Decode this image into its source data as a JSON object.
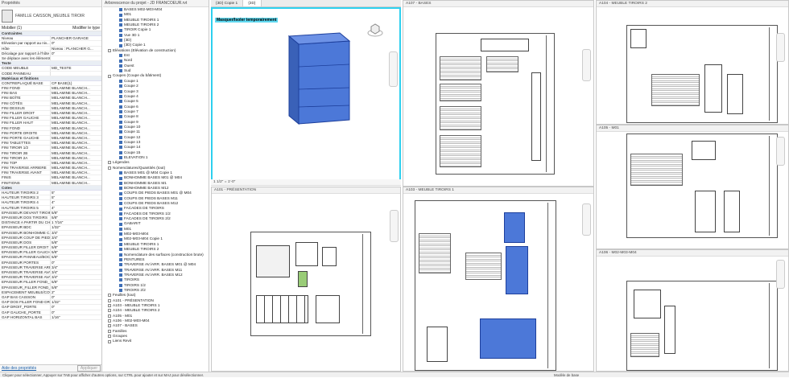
{
  "properties": {
    "title": "Propriétés",
    "type_name": "FAMILLE CAISSON_MEUBLE TIROIR",
    "instance_selector": "Mobilier (1)",
    "edit_type": "Modifier le type",
    "groups": [
      {
        "name": "Contraintes",
        "rows": [
          [
            "Niveau",
            "PLANCHER GARAGE"
          ],
          [
            "Elévation par rapport au niv...",
            "0\""
          ],
          [
            "Hôte",
            "Niveau : PLANCHER G..."
          ],
          [
            "Décalage par rapport à l'hôte",
            "0\""
          ],
          [
            "Se déplace avec les éléments...",
            ""
          ]
        ]
      },
      {
        "name": "Texte",
        "rows": [
          [
            "CODE MEUBLE",
            "MD_TESTE"
          ],
          [
            "CODE PANNEAU",
            ""
          ]
        ]
      },
      {
        "name": "Matériaux et finitions",
        "rows": [
          [
            "CONTREPLAQUÉ BASE",
            "CP BASE(1)"
          ],
          [
            "FINI FOND",
            "MELAMINE BLANCH..."
          ],
          [
            "FINI BAS",
            "MELAMINE BLANCH..."
          ],
          [
            "FINI BOÎTE",
            "MELAMINE BLANCH..."
          ],
          [
            "FINI CÔTÉS",
            "MELAMINE BLANCH..."
          ],
          [
            "FINI DESSUS",
            "MELAMINE BLANCH..."
          ],
          [
            "FINI FILLER DROIT",
            "MELAMINE BLANCH..."
          ],
          [
            "FINI FILLER GAUCHE",
            "MELAMINE BLANCH..."
          ],
          [
            "FINI FILLER HAUT",
            "MELAMINE BLANCH..."
          ],
          [
            "FINI FOND",
            "MELAMINE BLANCH..."
          ],
          [
            "FINI PORTE DROITE",
            "MELAMINE BLANCH..."
          ],
          [
            "FINI PORTE GAUCHE",
            "MELAMINE BLANCH..."
          ],
          [
            "FINI TABLETTES",
            "MELAMINE BLANCH..."
          ],
          [
            "FINI TIROIR 1/2",
            "MELAMINE BLANCH..."
          ],
          [
            "FINI TIROIR 2B",
            "MELAMINE BLANCH..."
          ],
          [
            "FINI TIROIR 2A",
            "MELAMINE BLANCH..."
          ],
          [
            "FINI TOP",
            "MELAMINE BLANCH..."
          ],
          [
            "FINI TRAVERSE ARRIERE",
            "MELAMINE BLANCH..."
          ],
          [
            "FINI TRAVERSE AVANT",
            "MELAMINE BLANCH..."
          ],
          [
            "FINIS",
            "MELAMINE BLANCH..."
          ],
          [
            "FINITIONS",
            "MELAMINE BLANCH..."
          ]
        ]
      },
      {
        "name": "Cotes",
        "rows": [
          [
            "HAUTEUR TIROIRS 2",
            "5\""
          ],
          [
            "HAUTEUR TIROIRS 3",
            "5\""
          ],
          [
            "HAUTEUR TIROIRS 4",
            "4\""
          ],
          [
            "HAUTEUR TIROIRS 5",
            "4\""
          ],
          [
            "EPAISSEUR DEVANT TIROIRS",
            "5/8\""
          ],
          [
            "EPAISSEUR DOS TIROIRS",
            "5/8\""
          ],
          [
            "DISTANCE A PARTIR DU CH...",
            "1 7/16\""
          ],
          [
            "EPAISSEUR BDC",
            "1/32\""
          ],
          [
            "EPAISSEUR BONHOMME C...",
            "3/4\""
          ],
          [
            "EPAISSEUR COUP DE PIED",
            "3/4\""
          ],
          [
            "EPAISSEUR DOS",
            "5/8\""
          ],
          [
            "EPAISSEUR FILLER DROIT",
            "5/8\""
          ],
          [
            "EPAISSEUR FILLER GAUCHE",
            "5/8\""
          ],
          [
            "EPAISSEUR PANNEAU/BOC",
            "5/8\""
          ],
          [
            "EPAISSEUR PORTES",
            "0\""
          ],
          [
            "EPAISSEUR TRAVERSE ARRIE...",
            "3/4\""
          ],
          [
            "EPAISSEUR TRAVERSE AVAN...",
            "3/4\""
          ],
          [
            "EPAISSEUR TRAVERSE AVAN...",
            "3/4\""
          ],
          [
            "EPAISSEUR FILLER FOND_DR...",
            "5/8\""
          ],
          [
            "EPAISSEUR_FILLER FOND_G...",
            "5/8\""
          ],
          [
            "ESPACEMENT MEUBLE/COU...",
            "2\""
          ],
          [
            "GAP BAS CAISSON",
            "0\""
          ],
          [
            "GAP DOS FILLER FOND DROIT",
            "1/32\""
          ],
          [
            "GAP DROIT_PORTE",
            "0\""
          ],
          [
            "GAP GAUCHE_PORTE",
            "0\""
          ],
          [
            "GAP HORIZONTAL BAS",
            "1/16\""
          ]
        ]
      }
    ],
    "help_link": "Aide des propriétés",
    "apply": "Appliquer"
  },
  "browser": {
    "title": "Arborescence du projet - JD FRANCOEUR.rvt",
    "items": [
      [
        "b",
        "BASES M02-M03-M04"
      ],
      [
        "b",
        "M01"
      ],
      [
        "b",
        "MEUBLE TIROIRS 1"
      ],
      [
        "b",
        "MEUBLE TIROIRS 2"
      ],
      [
        "b",
        "TIROIR Copie 1"
      ],
      [
        "b",
        "Vue 3D 1"
      ],
      [
        "b",
        "{3D}"
      ],
      [
        "b",
        "{3D} Copie 1"
      ],
      [
        "w",
        "Elévations (Elévation de construction)"
      ],
      [
        "b",
        "Est"
      ],
      [
        "b",
        "Nord"
      ],
      [
        "b",
        "Ouest"
      ],
      [
        "b",
        "Sud"
      ],
      [
        "w",
        "Coupes (Coupe du bâtiment)"
      ],
      [
        "b",
        "Coupe 1"
      ],
      [
        "b",
        "Coupe 2"
      ],
      [
        "b",
        "Coupe 3"
      ],
      [
        "b",
        "Coupe 4"
      ],
      [
        "b",
        "Coupe 5"
      ],
      [
        "b",
        "Coupe 6"
      ],
      [
        "b",
        "Coupe 7"
      ],
      [
        "b",
        "Coupe 8"
      ],
      [
        "b",
        "Coupe 9"
      ],
      [
        "b",
        "Coupe 10"
      ],
      [
        "b",
        "Coupe 11"
      ],
      [
        "b",
        "Coupe 12"
      ],
      [
        "b",
        "Coupe 13"
      ],
      [
        "b",
        "Coupe 14"
      ],
      [
        "b",
        "Coupe 15"
      ],
      [
        "b",
        "ELEVATION 1"
      ],
      [
        "w",
        "Légendes"
      ],
      [
        "w",
        "Nomenclatures/Quantités (tout)"
      ],
      [
        "b",
        "BASES M01 @ M04 Copie 1"
      ],
      [
        "b",
        "BONHOMME BASES M01 @ M04"
      ],
      [
        "b",
        "BONHOMME BASES M1"
      ],
      [
        "b",
        "BONHOMME BASES M12"
      ],
      [
        "b",
        "COUPS DE PIEDS BASES M01 @ M04"
      ],
      [
        "b",
        "COUPS DE PIEDS BASES M11"
      ],
      [
        "b",
        "COUPS DE PIEDS BASES M12"
      ],
      [
        "b",
        "FACADES DE TIROIRS"
      ],
      [
        "b",
        "FACADES DE TIROIRS 1/2"
      ],
      [
        "b",
        "FACADES DE TIROIRS 2/2"
      ],
      [
        "b",
        "GABARIT"
      ],
      [
        "b",
        "M01"
      ],
      [
        "b",
        "M02-M03-M04"
      ],
      [
        "b",
        "M02-M03-M04 Copie 1"
      ],
      [
        "b",
        "MEUBLE TIROIRS 1"
      ],
      [
        "b",
        "MEUBLE TIROIRS 2"
      ],
      [
        "b",
        "Nomenclature des surfaces (construction brute)"
      ],
      [
        "b",
        "PENTURES"
      ],
      [
        "b",
        "TRAVERSE AV./ARR. BASES M01 @ M04"
      ],
      [
        "b",
        "TRAVERSE AV./ARR. BASES M11"
      ],
      [
        "b",
        "TRAVERSE AV./ARR. BASES M12"
      ],
      [
        "b",
        "TIROIRS"
      ],
      [
        "b",
        "TIROIRS 1/2"
      ],
      [
        "b",
        "TIROIRS 2/2"
      ],
      [
        "w",
        "Feuilles (tout)"
      ],
      [
        "w",
        "A101 - PRÉSENTATION"
      ],
      [
        "w",
        "A103 - MEUBLE TIROIRS 1"
      ],
      [
        "w",
        "A104 - MEUBLE TIROIRS 2"
      ],
      [
        "w",
        "A105 - M01"
      ],
      [
        "w",
        "A106 - M02-M03-M04"
      ],
      [
        "w",
        "A107 - BASES"
      ],
      [
        "w",
        "Familles"
      ],
      [
        "w",
        "Groupes"
      ],
      [
        "w",
        "Liens Revit"
      ]
    ]
  },
  "tabs": [
    "{3D} Copie 1",
    "{3D}"
  ],
  "views": {
    "v3d_hint": "Masquer/Isoler temporairement",
    "a101": "A101 - PRÉSENTATION",
    "a107": "A107 - BASES",
    "a103": "A103 - MEUBLE TIROIRS 1",
    "a104": "A104 - MEUBLE TIROIRS 2",
    "a105": "A105 - M01",
    "a106": "A106 - M02-M03-M04",
    "scale": "1 1/2\" = 1'-0\""
  },
  "status": {
    "text": "Cliquer pour sélectionner, Appuyer sur TAB pour afficher d'autres options, sur CTRL pour ajouter et sur MAJ pour désélectionner.",
    "model": "Modèle de base"
  }
}
